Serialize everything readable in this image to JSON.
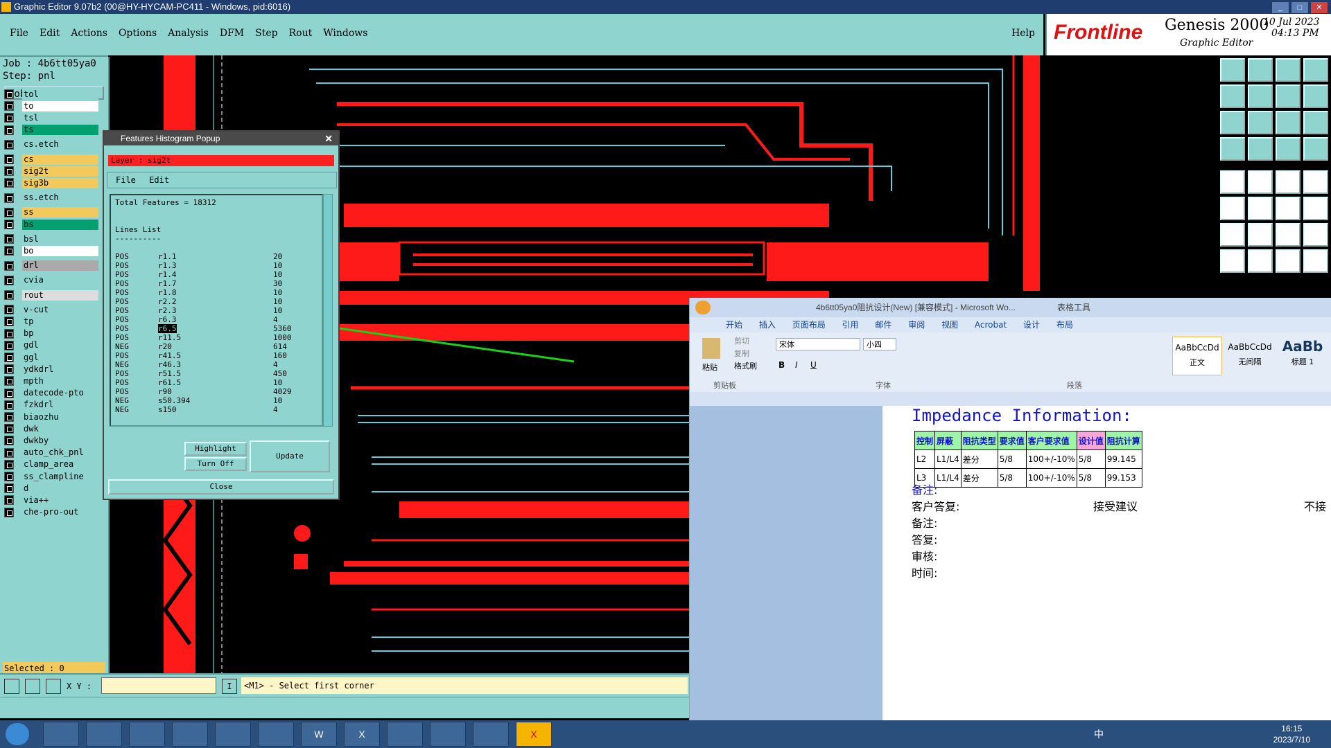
{
  "titlebar": {
    "title": "Graphic Editor 9.07b2 (00@HY-HYCAM-PC411 - Windows, pid:6016)",
    "buttons": [
      "_",
      "□",
      "✕"
    ]
  },
  "menu": {
    "items": [
      "File",
      "Edit",
      "Actions",
      "Options",
      "Analysis",
      "DFM",
      "Step",
      "Rout",
      "Windows"
    ],
    "help": "Help"
  },
  "brand": {
    "logo": "Frontline",
    "product": "Genesis 2000",
    "sub": "Graphic Editor",
    "date": "10 Jul 2023",
    "time": "04:13 PM"
  },
  "left": {
    "job": "Job : 4b6tt05ya0",
    "step": "Step: pnl",
    "job_matrix": "Job Matrix ...",
    "layers": [
      {
        "name": "tol",
        "color": "#8fd4cf"
      },
      {
        "name": "to",
        "color": "#ffffff"
      },
      {
        "name": "tsl",
        "color": "#8fd4cf"
      },
      {
        "name": "ts",
        "color": "#00a070"
      },
      {
        "name": "cs.etch",
        "color": "#8fd4cf"
      },
      {
        "name": "cs",
        "color": "#f3c95b"
      },
      {
        "name": "sig2t",
        "color": "#f3c95b"
      },
      {
        "name": "sig3b",
        "color": "#f3c95b"
      },
      {
        "name": "ss.etch",
        "color": "#8fd4cf"
      },
      {
        "name": "ss",
        "color": "#f3c95b"
      },
      {
        "name": "bs",
        "color": "#00a070"
      },
      {
        "name": "bsl",
        "color": "#8fd4cf"
      },
      {
        "name": "bo",
        "color": "#ffffff"
      },
      {
        "name": "drl",
        "color": "#aaaaaa"
      },
      {
        "name": "cvia",
        "color": "#8fd4cf"
      },
      {
        "name": "rout",
        "color": "#dddddd"
      },
      {
        "name": "v-cut",
        "color": "#8fd4cf"
      },
      {
        "name": "tp",
        "color": "#8fd4cf"
      },
      {
        "name": "bp",
        "color": "#8fd4cf"
      },
      {
        "name": "gdl",
        "color": "#8fd4cf"
      },
      {
        "name": "ggl",
        "color": "#8fd4cf"
      },
      {
        "name": "ydkdrl",
        "color": "#8fd4cf"
      },
      {
        "name": "mpth",
        "color": "#8fd4cf"
      },
      {
        "name": "datecode-pto",
        "color": "#8fd4cf"
      },
      {
        "name": "fzkdrl",
        "color": "#8fd4cf"
      },
      {
        "name": "biaozhu",
        "color": "#8fd4cf"
      },
      {
        "name": "dwk",
        "color": "#8fd4cf"
      },
      {
        "name": "dwkby",
        "color": "#8fd4cf"
      },
      {
        "name": "auto_chk_pnl",
        "color": "#8fd4cf"
      },
      {
        "name": "clamp_area",
        "color": "#8fd4cf"
      },
      {
        "name": "ss_clampline",
        "color": "#8fd4cf"
      },
      {
        "name": "d",
        "color": "#8fd4cf"
      },
      {
        "name": "via++",
        "color": "#8fd4cf"
      },
      {
        "name": "che-pro-out",
        "color": "#8fd4cf"
      }
    ],
    "selected": "Selected : 0"
  },
  "popup": {
    "title": "Features Histogram Popup",
    "layer": "Layer :  sig2t",
    "menu": [
      "File",
      "Edit"
    ],
    "total": "Total Features = 18312",
    "list_title": "Lines List",
    "list_rule": "----------",
    "rows": [
      [
        "POS",
        "r1.1",
        "20"
      ],
      [
        "POS",
        "r1.3",
        "10"
      ],
      [
        "POS",
        "r1.4",
        "10"
      ],
      [
        "POS",
        "r1.7",
        "30"
      ],
      [
        "POS",
        "r1.8",
        "10"
      ],
      [
        "POS",
        "r2.2",
        "10"
      ],
      [
        "POS",
        "r2.3",
        "10"
      ],
      [
        "POS",
        "r6.3",
        "4"
      ],
      [
        "POS",
        "r6.5",
        "5360"
      ],
      [
        "POS",
        "r11.5",
        "1000"
      ],
      [
        "NEG",
        "r20",
        "614"
      ],
      [
        "POS",
        "r41.5",
        "160"
      ],
      [
        "NEG",
        "r46.3",
        "4"
      ],
      [
        "POS",
        "r51.5",
        "450"
      ],
      [
        "POS",
        "r61.5",
        "10"
      ],
      [
        "POS",
        "r90",
        "4029"
      ],
      [
        "NEG",
        "s50.394",
        "10"
      ],
      [
        "NEG",
        "s150",
        "4"
      ]
    ],
    "buttons": {
      "highlight": "Highlight",
      "turn_off": "Turn Off",
      "update": "Update",
      "close": "Close"
    }
  },
  "cmd": {
    "xy_label": "X Y :",
    "prompt": "<M1> - Select first corner"
  },
  "word": {
    "title": "4b6tt05ya0阻抗设计(New) [兼容模式] - Microsoft Wo...",
    "context_tab": "表格工具",
    "tabs": [
      "开始",
      "插入",
      "页面布局",
      "引用",
      "邮件",
      "审阅",
      "视图",
      "Acrobat",
      "设计",
      "布局"
    ],
    "clipboard": {
      "paste": "粘贴",
      "cut": "剪切",
      "copy": "复制",
      "format": "格式刷",
      "group": "剪贴板"
    },
    "font": {
      "name": "宋体",
      "size": "小四",
      "group": "字体"
    },
    "paragraph_group": "段落",
    "styles": [
      {
        "sample": "AaBbCcDd",
        "name": "正文"
      },
      {
        "sample": "AaBbCcDd",
        "name": "无间隔"
      },
      {
        "sample": "AaBb",
        "name": "标题 1"
      }
    ],
    "doc": {
      "heading": "Impedance Information:",
      "table_header": [
        "控制",
        "屏蔽",
        "阻抗类型",
        "要求值",
        "客户要求值",
        "设计值",
        "阻抗计算"
      ],
      "table_rows": [
        [
          "L2",
          "L1/L4",
          "差分",
          "5/8",
          "100+/-10%",
          "5/8",
          "99.145"
        ],
        [
          "L3",
          "L1/L4",
          "差分",
          "5/8",
          "100+/-10%",
          "5/8",
          "99.153"
        ]
      ],
      "note1": "备注:",
      "reply_label": "客户答复:",
      "reply_accept": "接受建议",
      "reply_reject": "不接",
      "note2": "备注:",
      "answer": "答复:",
      "review": "审核:",
      "time": "时间:"
    }
  },
  "taskbar": {
    "time": "16:15",
    "date": "2023/7/10",
    "tray_lang": "中"
  }
}
